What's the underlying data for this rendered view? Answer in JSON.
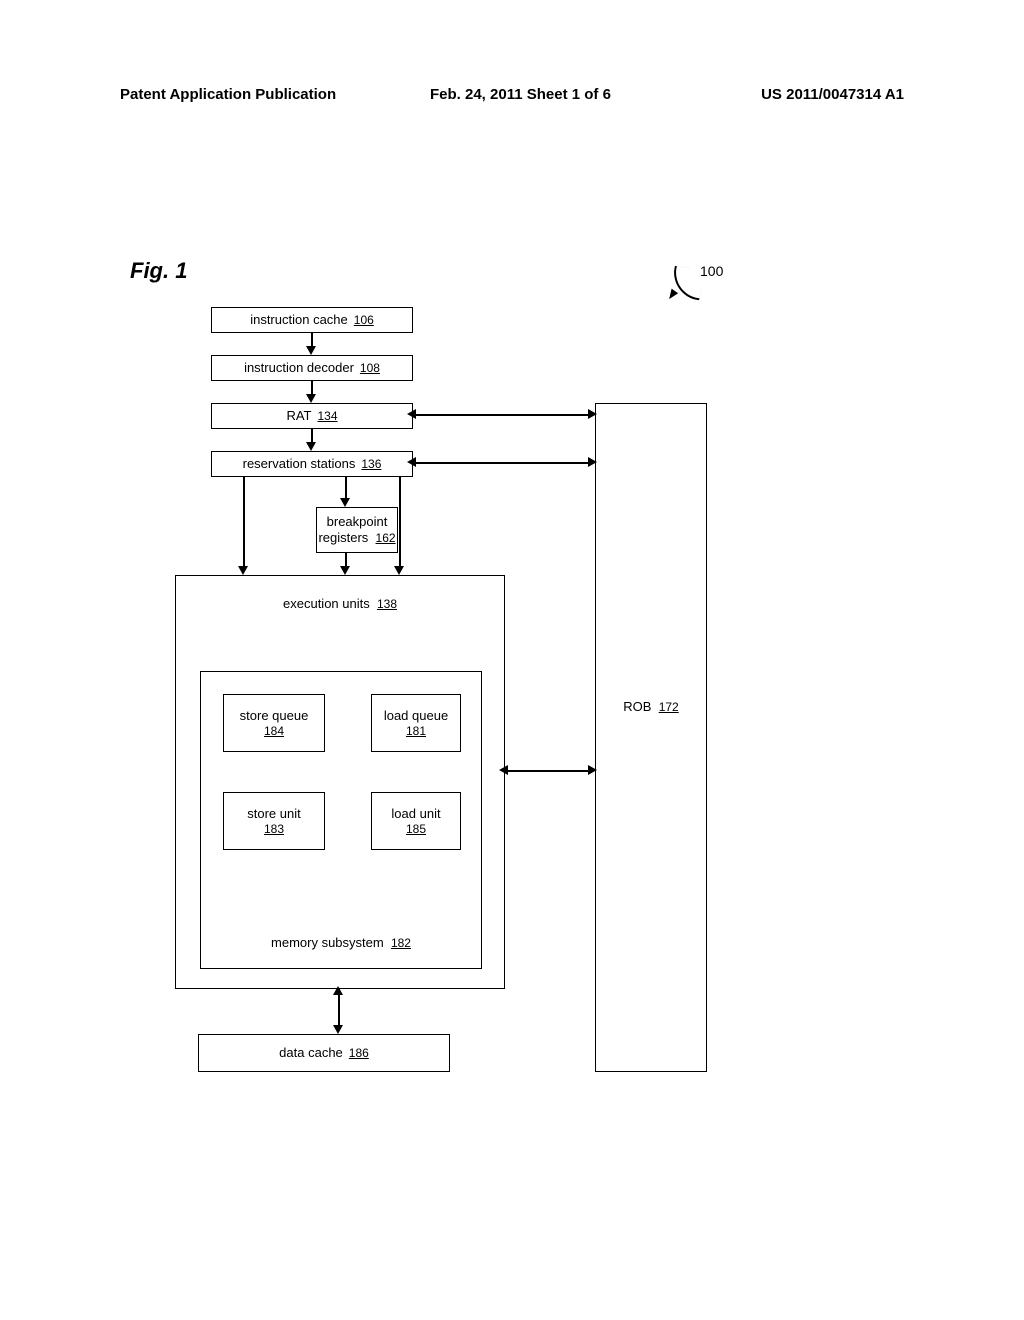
{
  "header": {
    "left": "Patent Application Publication",
    "center": "Feb. 24, 2011   Sheet 1 of 6",
    "right": "US 2011/0047314 A1"
  },
  "figure": {
    "label": "Fig. 1",
    "system_ref": "100"
  },
  "blocks": {
    "icache": {
      "label": "instruction cache",
      "ref": "106"
    },
    "idecoder": {
      "label": "instruction decoder",
      "ref": "108"
    },
    "rat": {
      "label": "RAT",
      "ref": "134"
    },
    "resv": {
      "label": "reservation stations",
      "ref": "136"
    },
    "bpreg": {
      "label1": "breakpoint",
      "label2": "registers",
      "ref": "162"
    },
    "exec": {
      "label": "execution units",
      "ref": "138"
    },
    "memsys": {
      "label": "memory subsystem",
      "ref": "182"
    },
    "storeq": {
      "label": "store queue",
      "ref": "184"
    },
    "loadq": {
      "label": "load queue",
      "ref": "181"
    },
    "storeu": {
      "label": "store unit",
      "ref": "183"
    },
    "loadu": {
      "label": "load unit",
      "ref": "185"
    },
    "dcache": {
      "label": "data cache",
      "ref": "186"
    },
    "rob": {
      "label": "ROB",
      "ref": "172"
    }
  }
}
